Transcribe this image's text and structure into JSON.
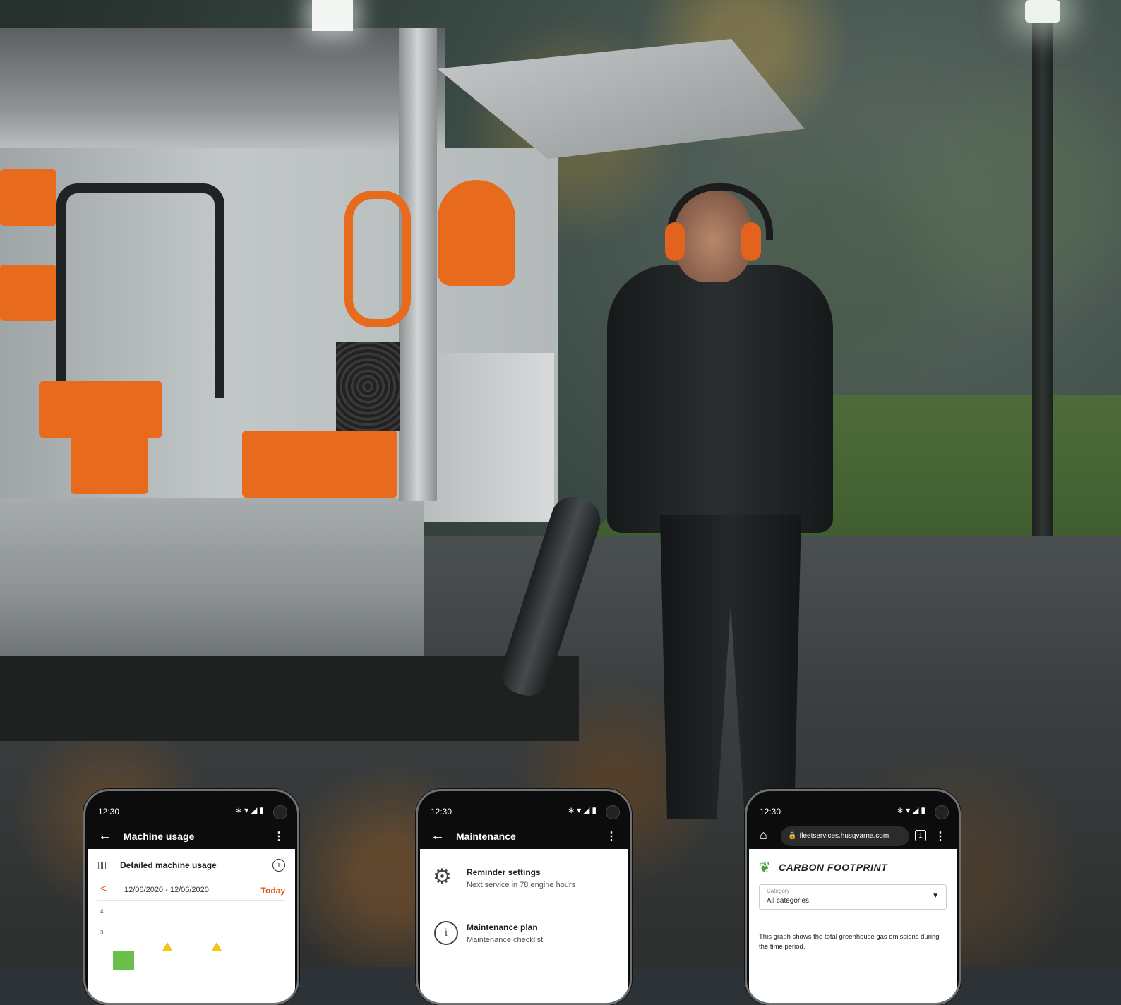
{
  "phones": [
    {
      "status": {
        "time": "12:30",
        "icons": "∗▾◢▮"
      },
      "appbar": {
        "back": "←",
        "title": "Machine usage",
        "more": "⋮"
      },
      "card": {
        "icon": "bar-chart-icon",
        "title": "Detailed machine usage",
        "info": "i",
        "prev": "<",
        "range": "12/06/2020 - 12/06/2020",
        "today": "Today"
      },
      "chart_ticks": [
        "4",
        "3"
      ],
      "colors": {
        "accent": "#e15a1f",
        "bar": "#6bc04b",
        "marker": "#f2c418"
      }
    },
    {
      "status": {
        "time": "12:30",
        "icons": "∗▾◢▮"
      },
      "appbar": {
        "back": "←",
        "title": "Maintenance",
        "more": "⋮"
      },
      "items": [
        {
          "icon": "gear-icon",
          "title": "Reminder settings",
          "subtitle": "Next service in 78 engine hours"
        },
        {
          "icon": "info-icon",
          "title": "Maintenance plan",
          "subtitle": "Maintenance checklist"
        }
      ]
    },
    {
      "status": {
        "time": "12:30",
        "icons": "∗▾◢▮"
      },
      "browser": {
        "home": "⌂",
        "url": "fleetservices.husqvarna.com",
        "tabs": "1",
        "more": "⋮"
      },
      "carbon": {
        "icon": "leaf-icon",
        "title": "CARBON FOOTPRINT",
        "select_label": "Category",
        "select_value": "All categories",
        "description": "This graph shows the total greenhouse gas emissions during the time period."
      }
    }
  ]
}
